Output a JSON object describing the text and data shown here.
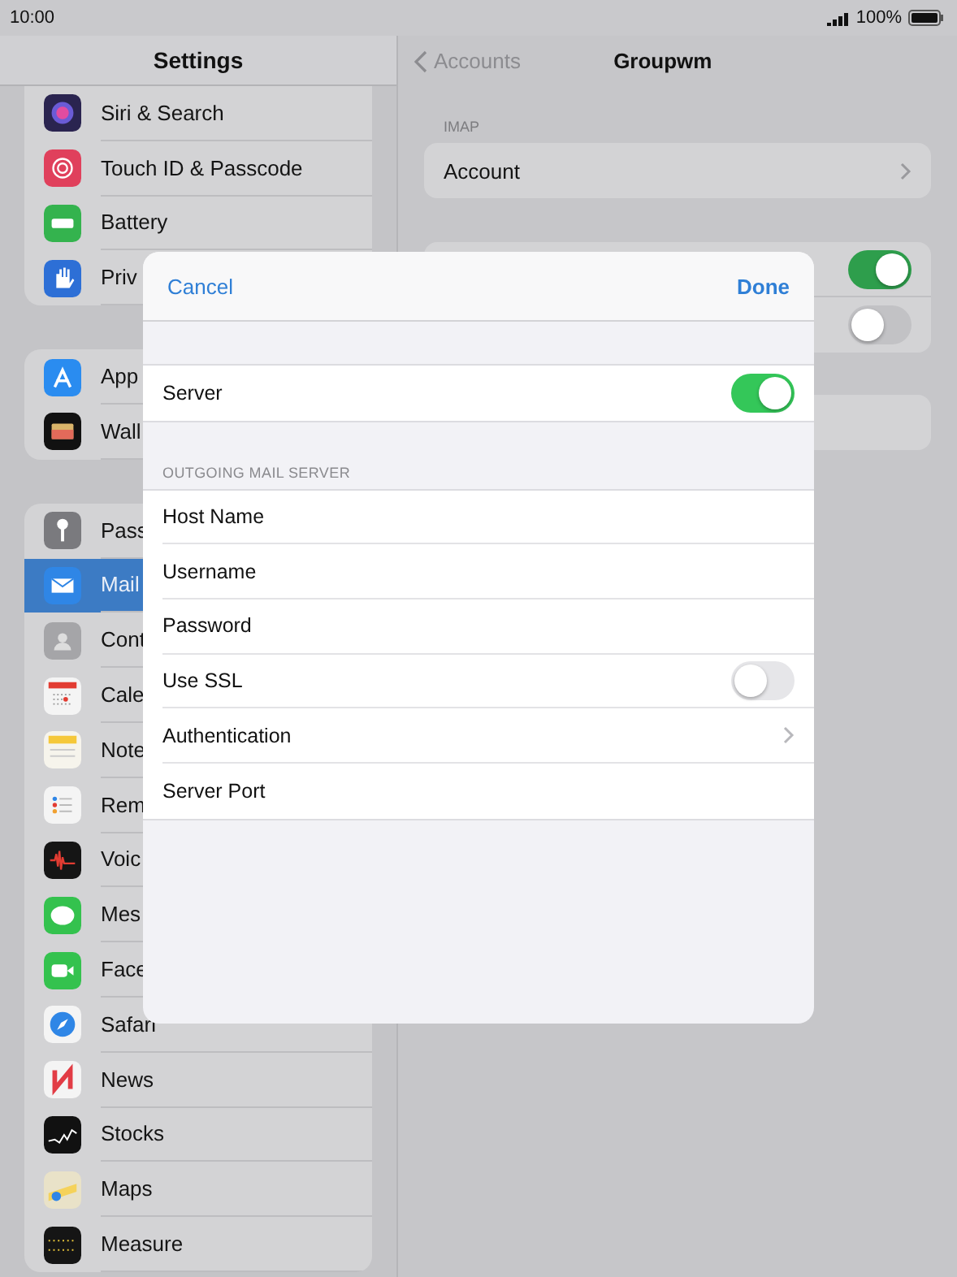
{
  "status_bar": {
    "time": "10:00",
    "battery": "100%"
  },
  "sidebar": {
    "title": "Settings",
    "groups": [
      [
        {
          "label": "Siri & Search",
          "kind": "siri",
          "selected": false
        },
        {
          "label": "Touch ID & Passcode",
          "kind": "touchid",
          "selected": false
        },
        {
          "label": "Battery",
          "kind": "battery",
          "selected": false
        },
        {
          "label": "Priv",
          "kind": "privacy",
          "selected": false
        }
      ],
      [
        {
          "label": "App",
          "kind": "appstore",
          "selected": false
        },
        {
          "label": "Wall",
          "kind": "wallet",
          "selected": false
        }
      ],
      [
        {
          "label": "Pass",
          "kind": "key",
          "selected": false
        },
        {
          "label": "Mail",
          "kind": "mail",
          "selected": true
        },
        {
          "label": "Cont",
          "kind": "contacts",
          "selected": false
        },
        {
          "label": "Cale",
          "kind": "calendar",
          "selected": false
        },
        {
          "label": "Note",
          "kind": "notes",
          "selected": false
        },
        {
          "label": "Rem",
          "kind": "reminders",
          "selected": false
        },
        {
          "label": "Voic",
          "kind": "voice",
          "selected": false
        },
        {
          "label": "Mes",
          "kind": "messages",
          "selected": false
        },
        {
          "label": "Face",
          "kind": "facetime",
          "selected": false
        },
        {
          "label": "Safari",
          "kind": "safari",
          "selected": false
        },
        {
          "label": "News",
          "kind": "news",
          "selected": false
        },
        {
          "label": "Stocks",
          "kind": "stocks",
          "selected": false
        },
        {
          "label": "Maps",
          "kind": "maps",
          "selected": false
        },
        {
          "label": "Measure",
          "kind": "measure",
          "selected": false
        }
      ]
    ]
  },
  "detail": {
    "back": "Accounts",
    "title": "Groupwm",
    "section": "IMAP",
    "account_row": "Account",
    "toggle_rows": [
      {
        "on": true
      },
      {
        "on": false
      }
    ]
  },
  "modal": {
    "cancel": "Cancel",
    "done": "Done",
    "server": {
      "label": "Server",
      "on": true
    },
    "section": "OUTGOING MAIL SERVER",
    "rows": [
      {
        "kind": "text",
        "label": "Host Name"
      },
      {
        "kind": "text",
        "label": "Username"
      },
      {
        "kind": "text",
        "label": "Password"
      },
      {
        "kind": "toggle",
        "label": "Use SSL",
        "on": false
      },
      {
        "kind": "link",
        "label": "Authentication"
      },
      {
        "kind": "text",
        "label": "Server Port"
      }
    ]
  }
}
